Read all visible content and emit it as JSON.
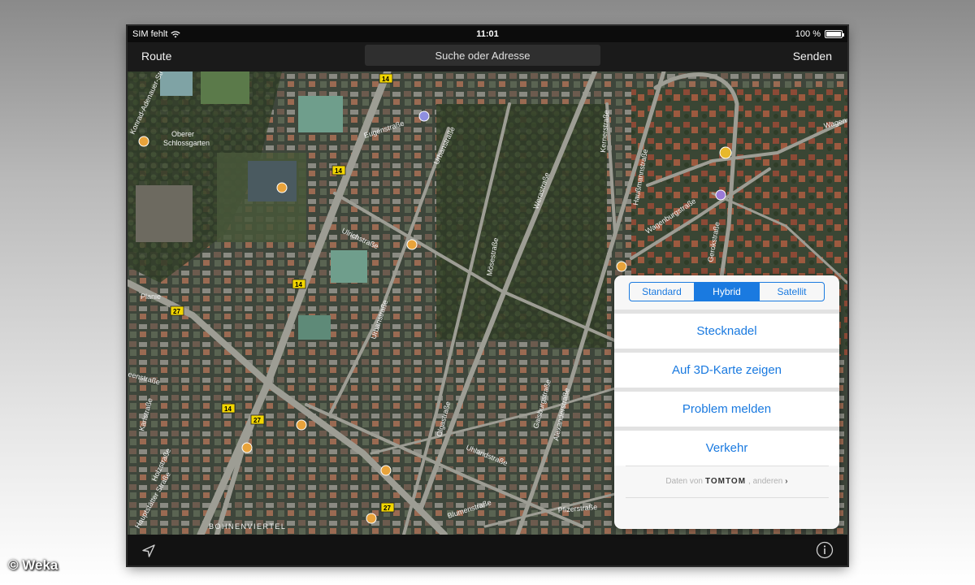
{
  "status_bar": {
    "carrier": "SIM fehlt",
    "time": "11:01",
    "battery": "100 %"
  },
  "nav_bar": {
    "left_button": "Route",
    "search_placeholder": "Suche oder Adresse",
    "right_button": "Senden"
  },
  "map": {
    "labels": {
      "eugenstrasse": "Eugenstraße",
      "urbanstrasse_top": "Urbanstraße",
      "ulrichstrasse": "Ulrichstraße",
      "urbanstrasse_mid": "Urbanstraße",
      "mosestrasse": "Mösestraße",
      "werastrasse": "Werastraße",
      "kernerstrasse": "Kernerstraße",
      "haussmannstrasse": "Haußmannstraße",
      "wagenburgstrasse": "Wagenburgstraße",
      "gerokstrasse": "Gerokstraße",
      "frasstrasse": "Fraasstraße",
      "wagenburg_right": "Wagen",
      "olgastrasse": "Olgastraße",
      "gaisburgstrasse": "Gaisburgstraße",
      "alexanderstrasse": "Alexanderstraße",
      "uhlandstrasse": "Uhlandstraße",
      "blumenstrasse": "Blumenstraße",
      "pfizerstrasse": "Pfizerstraße",
      "holzstrasse": "Holzstraße",
      "hauptstaetter": "Hauptstätter Straße",
      "planie": "Planie",
      "seenstrasse": "eenstraße",
      "karlstrasse": "Karlstraße",
      "oberer_schlossgarten_1": "Oberer",
      "oberer_schlossgarten_2": "Schlossgarten",
      "lenbachstrasse": "Konrad-Adenauer-Straße",
      "bohnenviertel": "BOHNENVIERTEL",
      "ugenstrasse": "Eugenstraße"
    },
    "route_badges": [
      "14",
      "14",
      "14",
      "27",
      "14",
      "27",
      "27"
    ]
  },
  "popover": {
    "segments": [
      "Standard",
      "Hybrid",
      "Satellit"
    ],
    "selected_segment": "Hybrid",
    "menu_items": [
      "Stecknadel",
      "Auf 3D-Karte zeigen",
      "Problem melden",
      "Verkehr"
    ],
    "credit_prefix": "Daten von",
    "credit_brand": "TOMTOM",
    "credit_suffix": ", anderen",
    "credit_chevron": "›"
  },
  "watermark": "© Weka",
  "colors": {
    "accent": "#1a7ae0",
    "badge_yellow": "#f2d600",
    "poi_orange": "#e8a33b",
    "bar_dark": "#1a1a1a"
  },
  "icons": {
    "wifi": "wifi-icon",
    "location": "location-arrow-icon",
    "info": "info-icon"
  }
}
